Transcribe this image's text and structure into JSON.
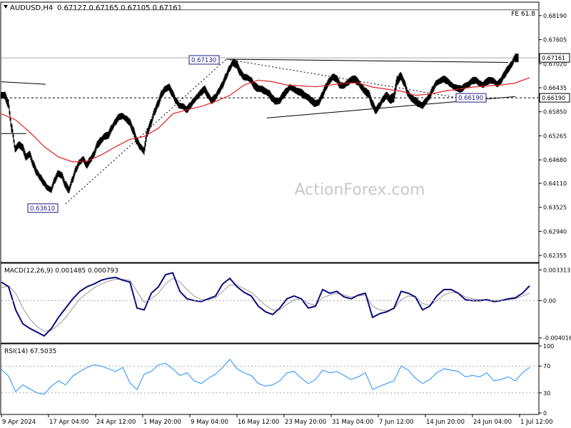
{
  "chart_data": {
    "type": "candlestick",
    "header": {
      "symbol": "AUDUSD,H4",
      "ohlc": "0.67127 0.67165 0.67105 0.67161"
    },
    "watermark": "ActionForex.com",
    "price_axis": {
      "ylim": [
        0.622,
        0.685
      ],
      "tick_labels": [
        "0.68190",
        "0.67605",
        "0.67020",
        "0.66435",
        "0.65850",
        "0.65265",
        "0.64680",
        "0.64110",
        "0.63525",
        "0.62940",
        "0.62355"
      ],
      "tick_values": [
        0.6819,
        0.67605,
        0.6702,
        0.66435,
        0.6585,
        0.65265,
        0.6468,
        0.6411,
        0.63525,
        0.6294,
        0.62355
      ],
      "current_price_label": "0.67161",
      "current_price": 0.67161,
      "level_label": "0.66190",
      "level": 0.6619
    },
    "annotations": {
      "fe_label": "FE 61.8",
      "fe_level": 0.6833,
      "high_label": "0.67130",
      "high_value": 0.6713,
      "low_label": "0.63610",
      "low_value": 0.6361,
      "mid_low_label": "0.66190",
      "mid_low_value": 0.6619
    },
    "price_series": {
      "name": "",
      "x": [
        0,
        5,
        10,
        15,
        20,
        25,
        30,
        35,
        40,
        45,
        50,
        55,
        60,
        65,
        70,
        75,
        80,
        85,
        90,
        95,
        100,
        105,
        110,
        115,
        120,
        125,
        130,
        135,
        140,
        145,
        150,
        155,
        160,
        165,
        170,
        175,
        180,
        185,
        190,
        195,
        200,
        205,
        210,
        215,
        220,
        225,
        230,
        235,
        240,
        245,
        250,
        255,
        260,
        265,
        270,
        275,
        280,
        285,
        290,
        295,
        300,
        305,
        310,
        315,
        320,
        325,
        330,
        335,
        340,
        345,
        350,
        355,
        360,
        365,
        370,
        375,
        380,
        385,
        390,
        395,
        400,
        405,
        410,
        415,
        420,
        425,
        430,
        435,
        440,
        445,
        450,
        455,
        460,
        465,
        470,
        475,
        480,
        485,
        490,
        495,
        500,
        505,
        510,
        515,
        520,
        525,
        530,
        535,
        540,
        545,
        550,
        555,
        560,
        565,
        570,
        575,
        580,
        585,
        590,
        595,
        600,
        605,
        610,
        615,
        620,
        625,
        630,
        635,
        640,
        645,
        650,
        655,
        660,
        665,
        670,
        675,
        680,
        685,
        690,
        695,
        700,
        705,
        710,
        715,
        720,
        725,
        730,
        735,
        740
      ],
      "close": [
        0.6625,
        0.6605,
        0.6545,
        0.6495,
        0.6505,
        0.6498,
        0.6475,
        0.6482,
        0.6458,
        0.6438,
        0.6425,
        0.6412,
        0.64,
        0.6395,
        0.6418,
        0.6435,
        0.643,
        0.6408,
        0.6395,
        0.642,
        0.6445,
        0.6462,
        0.647,
        0.6455,
        0.6468,
        0.6482,
        0.6505,
        0.6515,
        0.6525,
        0.6528,
        0.6545,
        0.656,
        0.6572,
        0.6575,
        0.6568,
        0.656,
        0.654,
        0.6515,
        0.65,
        0.649,
        0.6535,
        0.6558,
        0.6585,
        0.6605,
        0.6628,
        0.664,
        0.6645,
        0.663,
        0.6612,
        0.66,
        0.6598,
        0.659,
        0.66,
        0.6612,
        0.6622,
        0.6632,
        0.664,
        0.6625,
        0.6612,
        0.662,
        0.6635,
        0.665,
        0.667,
        0.669,
        0.6705,
        0.67,
        0.6682,
        0.667,
        0.6668,
        0.6662,
        0.6648,
        0.6642,
        0.664,
        0.6635,
        0.663,
        0.6618,
        0.661,
        0.6612,
        0.6625,
        0.6635,
        0.6645,
        0.664,
        0.6635,
        0.6632,
        0.6625,
        0.662,
        0.6612,
        0.6605,
        0.6608,
        0.6625,
        0.6645,
        0.666,
        0.667,
        0.6665,
        0.665,
        0.6648,
        0.6655,
        0.6662,
        0.6665,
        0.6658,
        0.6645,
        0.6635,
        0.6628,
        0.6605,
        0.6588,
        0.66,
        0.6615,
        0.6625,
        0.6615,
        0.662,
        0.666,
        0.6672,
        0.6655,
        0.663,
        0.6618,
        0.6612,
        0.6605,
        0.66,
        0.661,
        0.6622,
        0.664,
        0.6655,
        0.666,
        0.6665,
        0.666,
        0.6652,
        0.6645,
        0.6642,
        0.664,
        0.6648,
        0.6652,
        0.666,
        0.6662,
        0.6655,
        0.665,
        0.6658,
        0.6662,
        0.666,
        0.6652,
        0.666,
        0.6675,
        0.6688,
        0.67,
        0.6716,
        0.6716
      ],
      "range": [
        0.002,
        0.0024,
        0.0026,
        0.0022,
        0.0018,
        0.002,
        0.0022,
        0.0018,
        0.002,
        0.0022,
        0.0018,
        0.002,
        0.0018,
        0.0016,
        0.0018,
        0.002,
        0.0018,
        0.002,
        0.0022,
        0.0018,
        0.002,
        0.0018,
        0.0016,
        0.0018,
        0.002,
        0.0018,
        0.002,
        0.0022,
        0.0018,
        0.002,
        0.0022,
        0.0018,
        0.002,
        0.0018,
        0.0016,
        0.002,
        0.0022,
        0.0024,
        0.002,
        0.0018,
        0.0026,
        0.0022,
        0.002,
        0.0022,
        0.0024,
        0.002,
        0.0018,
        0.0022,
        0.002,
        0.0018,
        0.0016,
        0.0018,
        0.002,
        0.0018,
        0.0016,
        0.0018,
        0.002,
        0.0022,
        0.0018,
        0.002,
        0.0018,
        0.002,
        0.0022,
        0.002,
        0.0018,
        0.0022,
        0.0024,
        0.002,
        0.0018,
        0.0016,
        0.002,
        0.0022,
        0.0018,
        0.002,
        0.0018,
        0.0022,
        0.002,
        0.0018,
        0.002,
        0.0022,
        0.0018,
        0.0016,
        0.0018,
        0.002,
        0.0022,
        0.0018,
        0.002,
        0.0022,
        0.0018,
        0.002,
        0.0022,
        0.002,
        0.0018,
        0.002,
        0.0022,
        0.0018,
        0.0016,
        0.0018,
        0.002,
        0.0022,
        0.0018,
        0.002,
        0.0022,
        0.0024,
        0.0022,
        0.002,
        0.0018,
        0.002,
        0.0022,
        0.0026,
        0.003,
        0.0024,
        0.0022,
        0.002,
        0.0018,
        0.002,
        0.0022,
        0.0018,
        0.002,
        0.0018,
        0.002,
        0.0018,
        0.0016,
        0.0018,
        0.002,
        0.0018,
        0.0016,
        0.0018,
        0.002,
        0.0018,
        0.0016,
        0.0018,
        0.002,
        0.0018,
        0.0016,
        0.0018,
        0.002,
        0.0018,
        0.0016,
        0.0018,
        0.002,
        0.0022,
        0.002,
        0.0018,
        0.0026,
        0.0012
      ]
    },
    "ma_series": {
      "name": "",
      "color": "#e02020",
      "x": [
        0,
        20,
        40,
        60,
        80,
        100,
        120,
        140,
        160,
        180,
        200,
        220,
        240,
        260,
        280,
        300,
        320,
        340,
        360,
        380,
        400,
        420,
        440,
        460,
        480,
        500,
        520,
        540,
        560,
        580,
        600,
        620,
        640,
        660,
        680,
        700,
        720,
        740
      ],
      "y": [
        0.658,
        0.6565,
        0.6535,
        0.65,
        0.6475,
        0.6463,
        0.6465,
        0.648,
        0.65,
        0.6518,
        0.6525,
        0.6545,
        0.658,
        0.659,
        0.6598,
        0.661,
        0.6625,
        0.665,
        0.6662,
        0.6658,
        0.665,
        0.6648,
        0.6646,
        0.665,
        0.6655,
        0.6655,
        0.6645,
        0.664,
        0.6635,
        0.6625,
        0.6628,
        0.6635,
        0.664,
        0.6645,
        0.6648,
        0.665,
        0.6655,
        0.6668
      ]
    },
    "trend_lines": [
      {
        "x": [
          0,
          62
        ],
        "y": [
          0.6658,
          0.6652
        ],
        "style": "solid"
      },
      {
        "x": [
          0,
          35
        ],
        "y": [
          0.6532,
          0.6532
        ],
        "style": "solid"
      },
      {
        "x": [
          315,
          710
        ],
        "y": [
          0.6713,
          0.6705
        ],
        "style": "solid"
      },
      {
        "x": [
          372,
          720
        ],
        "y": [
          0.657,
          0.6622
        ],
        "style": "solid"
      },
      {
        "x": [
          90,
          315
        ],
        "y": [
          0.6361,
          0.6713
        ],
        "style": "dashed"
      },
      {
        "x": [
          315,
          640
        ],
        "y": [
          0.6713,
          0.6619
        ],
        "style": "dashed"
      }
    ],
    "macd": {
      "label": "MACD(12,26,9) 0.001485 0.000793",
      "tick_labels": [
        "0.003313",
        "0.00",
        "-0.004016"
      ],
      "tick_values": [
        0.003313,
        0.0,
        -0.004016
      ],
      "ylim": [
        -0.0045,
        0.0038
      ],
      "x": [
        0,
        10,
        20,
        30,
        40,
        50,
        60,
        70,
        80,
        90,
        100,
        110,
        120,
        130,
        140,
        150,
        160,
        170,
        180,
        190,
        200,
        210,
        220,
        230,
        240,
        250,
        260,
        270,
        280,
        290,
        300,
        310,
        320,
        330,
        340,
        350,
        360,
        370,
        380,
        390,
        400,
        410,
        420,
        430,
        440,
        450,
        460,
        470,
        480,
        490,
        500,
        510,
        520,
        530,
        540,
        550,
        560,
        570,
        580,
        590,
        600,
        610,
        620,
        630,
        640,
        650,
        660,
        670,
        680,
        690,
        700,
        710,
        720,
        730,
        740
      ],
      "macd_line": [
        0.002,
        0.0015,
        -0.001,
        -0.0025,
        -0.003,
        -0.0034,
        -0.0038,
        -0.003,
        -0.0018,
        -0.0008,
        0.0002,
        0.001,
        0.0015,
        0.0018,
        0.0022,
        0.0024,
        0.0025,
        0.0022,
        0.002,
        -0.0008,
        -0.001,
        0.0008,
        0.0015,
        0.0028,
        0.003,
        0.001,
        0.0002,
        0.0,
        -0.0001,
        0.0002,
        0.0005,
        0.0018,
        0.0024,
        0.0015,
        0.0009,
        0.0005,
        -0.0006,
        -0.0012,
        -0.0015,
        -0.0008,
        0.0002,
        0.0005,
        0.0002,
        -0.0008,
        -0.0006,
        0.0012,
        0.0008,
        0.001,
        0.0004,
        0.0002,
        0.0006,
        0.0008,
        -0.0018,
        -0.0014,
        -0.0012,
        -0.0008,
        0.001,
        0.0008,
        0.0004,
        -0.001,
        -0.0006,
        0.0005,
        0.0012,
        0.0012,
        0.0008,
        0.0001,
        0.0,
        0.0,
        0.0001,
        -0.0001,
        0.0,
        0.0002,
        0.0003,
        0.0008,
        0.0016
      ],
      "signal_line": [
        0.0014,
        0.0016,
        0.0008,
        -0.0008,
        -0.002,
        -0.0028,
        -0.0033,
        -0.0032,
        -0.0026,
        -0.0018,
        -0.0008,
        0.0002,
        0.0008,
        0.0014,
        0.0018,
        0.0021,
        0.0023,
        0.0023,
        0.0022,
        0.001,
        -0.0002,
        0.0002,
        0.0008,
        0.0018,
        0.0024,
        0.002,
        0.0012,
        0.0005,
        0.0001,
        0.0001,
        0.0003,
        0.001,
        0.0017,
        0.0017,
        0.0013,
        0.0009,
        0.0002,
        -0.0005,
        -0.001,
        -0.001,
        -0.0004,
        0.0001,
        0.0002,
        -0.0003,
        -0.0005,
        0.0003,
        0.0006,
        0.0008,
        0.0006,
        0.0004,
        0.0005,
        0.0006,
        -0.0006,
        -0.001,
        -0.0011,
        -0.0009,
        0.0001,
        0.0005,
        0.0004,
        -0.0003,
        -0.0005,
        0.0,
        0.0006,
        0.0009,
        0.0008,
        0.0004,
        0.0002,
        0.0001,
        0.0001,
        0.0,
        0.0,
        0.0001,
        0.0002,
        0.0005,
        0.0008
      ]
    },
    "rsi": {
      "label": "RSI(14) 67.5035",
      "tick_labels": [
        "100",
        "70",
        "30",
        "0"
      ],
      "tick_values": [
        100,
        70,
        30,
        0
      ],
      "ylim": [
        0,
        100
      ],
      "levels": [
        70,
        30
      ],
      "color": "#1e90ff",
      "x": [
        0,
        10,
        20,
        30,
        40,
        50,
        60,
        70,
        80,
        90,
        100,
        110,
        120,
        130,
        140,
        150,
        160,
        170,
        180,
        190,
        200,
        210,
        220,
        230,
        240,
        250,
        260,
        270,
        280,
        290,
        300,
        310,
        320,
        330,
        340,
        350,
        360,
        370,
        380,
        390,
        400,
        410,
        420,
        430,
        440,
        450,
        460,
        470,
        480,
        490,
        500,
        510,
        520,
        530,
        540,
        550,
        560,
        570,
        580,
        590,
        600,
        610,
        620,
        630,
        640,
        650,
        660,
        670,
        680,
        690,
        700,
        710,
        720,
        730,
        740
      ],
      "y": [
        65,
        55,
        32,
        42,
        36,
        30,
        28,
        40,
        48,
        42,
        55,
        62,
        68,
        72,
        70,
        66,
        62,
        68,
        45,
        35,
        58,
        62,
        72,
        74,
        66,
        56,
        60,
        48,
        44,
        52,
        58,
        68,
        80,
        66,
        60,
        56,
        44,
        40,
        42,
        48,
        60,
        62,
        52,
        44,
        50,
        64,
        60,
        62,
        56,
        50,
        54,
        60,
        35,
        40,
        44,
        48,
        70,
        64,
        52,
        44,
        50,
        60,
        66,
        64,
        62,
        54,
        56,
        54,
        60,
        48,
        50,
        54,
        48,
        60,
        68
      ]
    },
    "x_axis": {
      "tick_labels": [
        "9 Apr 2024",
        "17 Apr 04:00",
        "24 Apr 12:00",
        "1 May 20:00",
        "9 May 04:00",
        "16 May 12:00",
        "23 May 20:00",
        "31 May 04:00",
        "7 Jun 12:00",
        "14 Jun 20:00",
        "24 Jun 04:00",
        "1 Jul 12:00"
      ],
      "tick_positions": [
        0,
        66,
        132,
        198,
        264,
        330,
        396,
        462,
        528,
        594,
        660,
        726
      ]
    }
  }
}
